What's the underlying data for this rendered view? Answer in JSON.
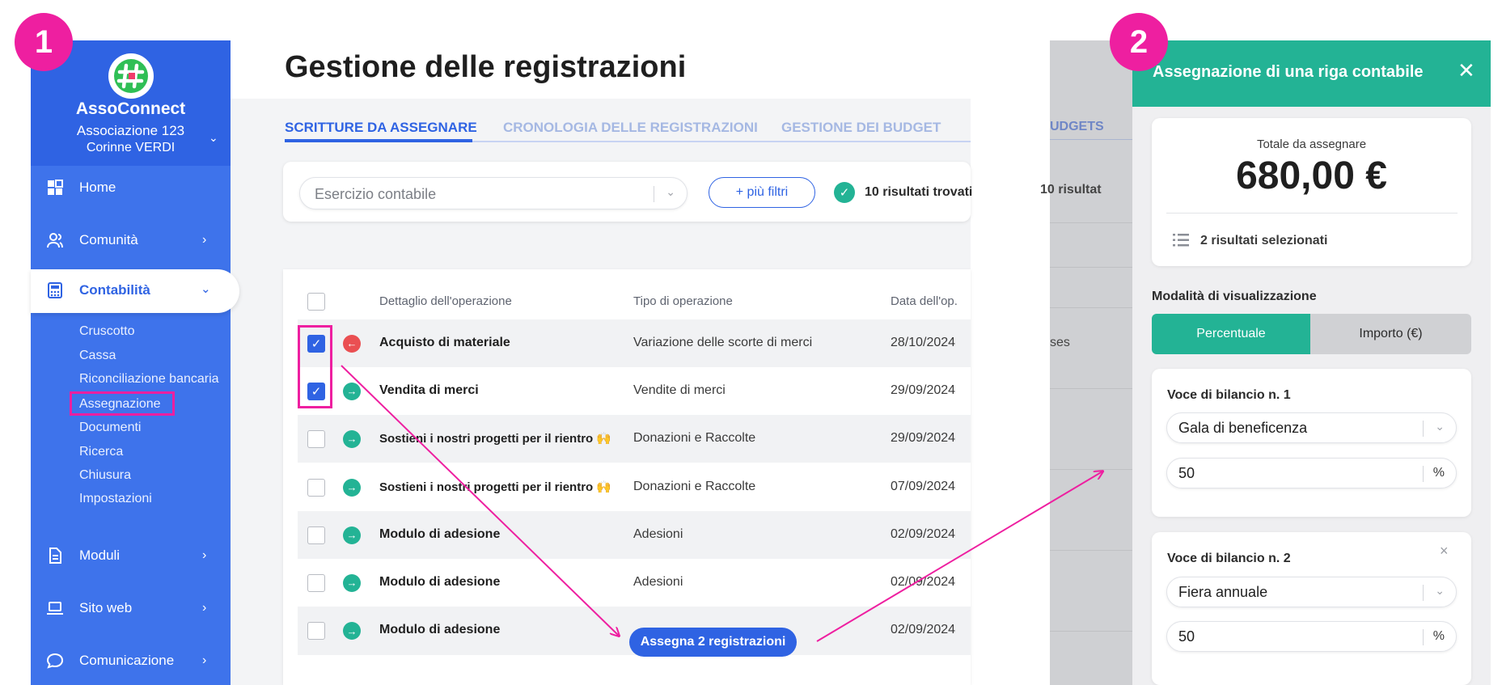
{
  "badges": {
    "one": "1",
    "two": "2"
  },
  "sidebar": {
    "org_name": "AssoConnect",
    "org_sub": "Associazione 123",
    "org_user": "Corinne VERDI",
    "nav": {
      "home": "Home",
      "community": "Comunità",
      "accounting": "Contabilità",
      "modules": "Moduli",
      "website": "Sito web",
      "communication": "Comunicazione"
    },
    "subnav": [
      "Cruscotto",
      "Cassa",
      "Riconciliazione bancaria",
      "Assegnazione",
      "Documenti",
      "Ricerca",
      "Chiusura",
      "Impostazioni"
    ]
  },
  "main": {
    "title": "Gestione delle registrazioni",
    "tabs": [
      "SCRITTURE DA ASSEGNARE",
      "CRONOLOGIA DELLE REGISTRAZIONI",
      "GESTIONE DEI BUDGET"
    ],
    "filter_placeholder": "Esercizio contabile",
    "more_filters": "+ più filtri",
    "results": "10 risultati trovati",
    "columns": [
      "Dettaglio dell'operazione",
      "Tipo di operazione",
      "Data dell'op."
    ],
    "rows": [
      {
        "op": "Acquisto di materiale",
        "type": "Variazione delle scorte di merci",
        "date": "28/10/2024",
        "checked": true,
        "dir": "out"
      },
      {
        "op": "Vendita di merci",
        "type": "Vendite di merci",
        "date": "29/09/2024",
        "checked": true,
        "dir": "in"
      },
      {
        "op": "Sostieni i nostri progetti per il rientro 🙌",
        "type": "Donazioni e Raccolte",
        "date": "29/09/2024",
        "checked": false,
        "dir": "in"
      },
      {
        "op": "Sostieni i nostri progetti per il rientro 🙌",
        "type": "Donazioni e Raccolte",
        "date": "07/09/2024",
        "checked": false,
        "dir": "in"
      },
      {
        "op": "Modulo di adesione",
        "type": "Adesioni",
        "date": "02/09/2024",
        "checked": false,
        "dir": "in"
      },
      {
        "op": "Modulo di adesione",
        "type": "Adesioni",
        "date": "02/09/2024",
        "checked": false,
        "dir": "in"
      },
      {
        "op": "Modulo di adesione",
        "type": "",
        "date": "02/09/2024",
        "checked": false,
        "dir": "in"
      }
    ],
    "assign_button": "Assegna 2 registrazioni"
  },
  "backdrop": {
    "tab_fragment": "UDGETS",
    "results_fragment": "10 risultat",
    "row_fragment": "ses"
  },
  "drawer": {
    "title": "Assegnazione di una riga contabile",
    "close": "✕",
    "total_label": "Totale da assegnare",
    "total_value": "680,00 €",
    "selected": "2 risultati selezionati",
    "mode_label": "Modalità di visualizzazione",
    "mode_percent": "Percentuale",
    "mode_amount": "Importo (€)",
    "items": [
      {
        "label": "Voce di bilancio n. 1",
        "value": "Gala di beneficenza",
        "amount": "50",
        "unit": "%"
      },
      {
        "label": "Voce di bilancio n. 2",
        "value": "Fiera annuale",
        "amount": "50",
        "unit": "%"
      }
    ]
  },
  "colors": {
    "brand_blue": "#2f63e3",
    "teal": "#23b395",
    "magenta": "#ee1fa0",
    "red": "#ea4f52"
  }
}
